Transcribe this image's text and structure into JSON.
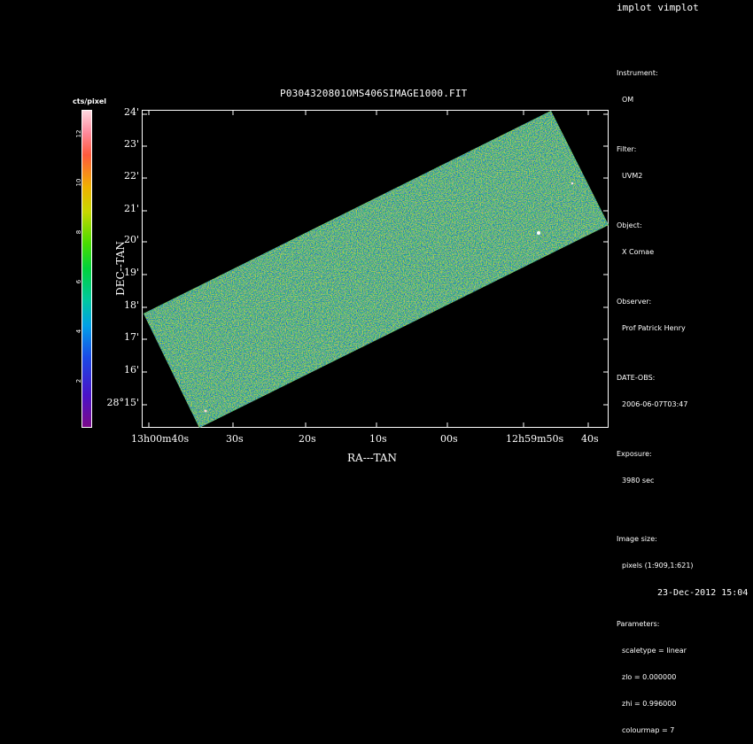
{
  "header": {
    "title": "implot vimplot"
  },
  "plot": {
    "title": "P0304320801OMS406SIMAGE1000.FIT",
    "xlabel": "RA---TAN",
    "ylabel": "DEC--TAN",
    "y_ticks": [
      "24'",
      "23'",
      "22'",
      "21'",
      "20'",
      "19'",
      "18'",
      "17'",
      "16'",
      "28°15'"
    ],
    "x_ticks": [
      "13h00m40s",
      "30s",
      "20s",
      "10s",
      "00s",
      "12h59m50s",
      "40s"
    ]
  },
  "colorbar": {
    "unit": "cts/pixel",
    "ticks": [
      "12",
      "10",
      "8",
      "6",
      "4",
      "2"
    ]
  },
  "info": {
    "instrument_label": "Instrument:",
    "instrument_value": "OM",
    "filter_label": "Filter:",
    "filter_value": "UVM2",
    "object_label": "Object:",
    "object_value": "X Comae",
    "observer_label": "Observer:",
    "observer_value": "Prof Patrick Henry",
    "date_label": "DATE-OBS:",
    "date_value": "2006-06-07T03:47",
    "exposure_label": "Exposure:",
    "exposure_value": "3980 sec",
    "imagesize_label": "Image size:",
    "imagesize_value": "pixels (1:909,1:621)",
    "params_label": "Parameters:",
    "param_scaletype": "scaletype = linear",
    "param_zlo": "zlo = 0.000000",
    "param_zhi": "zhi = 0.996000",
    "param_colourmap": "colourmap = 7"
  },
  "footer": {
    "timestamp": "23-Dec-2012 15:04"
  }
}
